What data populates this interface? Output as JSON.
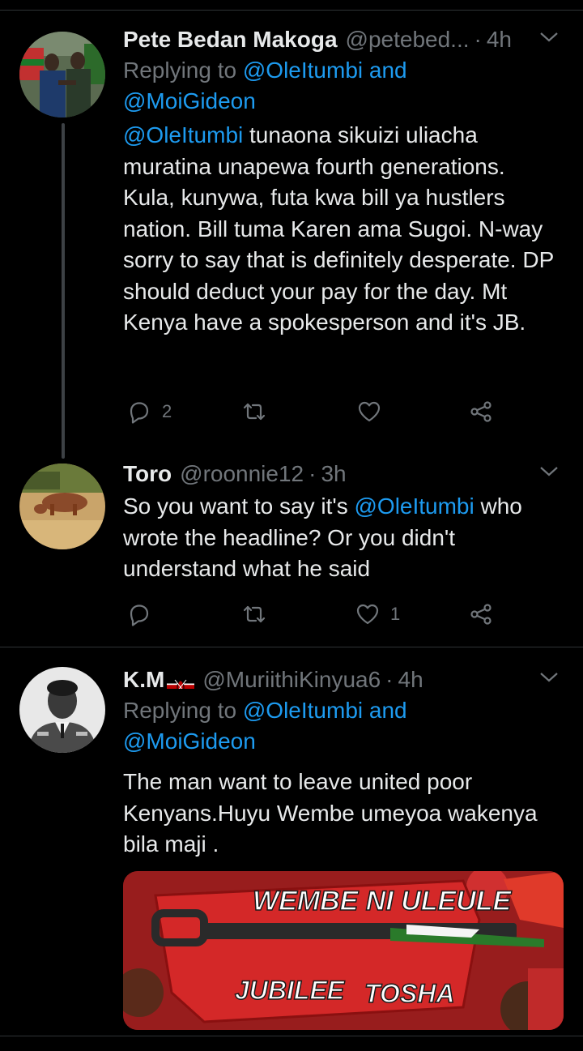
{
  "tweets": [
    {
      "name": "Pete Bedan Makoga",
      "handle": "@petebed...",
      "time": "4h",
      "reply_prefix": "Replying to",
      "reply_mention_1": "@OleItumbi",
      "reply_and": "and",
      "reply_mention_2": "@MoiGideon",
      "text_mention": "@OleItumbi",
      "text_rest": " tunaona sikuizi uliacha muratina unapewa fourth generations. Kula, kunywa, futa kwa bill ya hustlers nation. Bill tuma Karen ama Sugoi. N-way sorry to say that is definitely desperate. DP should deduct your pay for the day. Mt Kenya have a spokesperson and it's JB.",
      "reply_count": "2",
      "retweet_count": "",
      "like_count": ""
    },
    {
      "name": "Toro",
      "handle": "@roonnie12",
      "time": "3h",
      "text_before": "So you want to say it's ",
      "text_mention": "@OleItumbi",
      "text_after": " who wrote the headline? Or you didn't understand what he said",
      "reply_count": "",
      "retweet_count": "",
      "like_count": "1"
    },
    {
      "name": "K.M",
      "handle": "@MuriithiKinyua6",
      "time": "4h",
      "reply_prefix": "Replying to",
      "reply_mention_1": "@OleItumbi",
      "reply_and": "and",
      "reply_mention_2": "@MoiGideon",
      "text": "The man want to leave united poor Kenyans.Huyu Wembe umeyoa wakenya bila maji .",
      "image_text_top": "WEMBE NI ULEULE",
      "image_text_left": "JUBILEE",
      "image_text_right": "TOSHA"
    }
  ],
  "icons": [
    "reply-icon",
    "retweet-icon",
    "like-icon",
    "share-icon",
    "caret-down-icon",
    "kenya-flag-icon"
  ],
  "colors": {
    "background": "#000000",
    "link": "#1d9bf0",
    "muted": "#71767b",
    "text": "#e7e9ea"
  }
}
